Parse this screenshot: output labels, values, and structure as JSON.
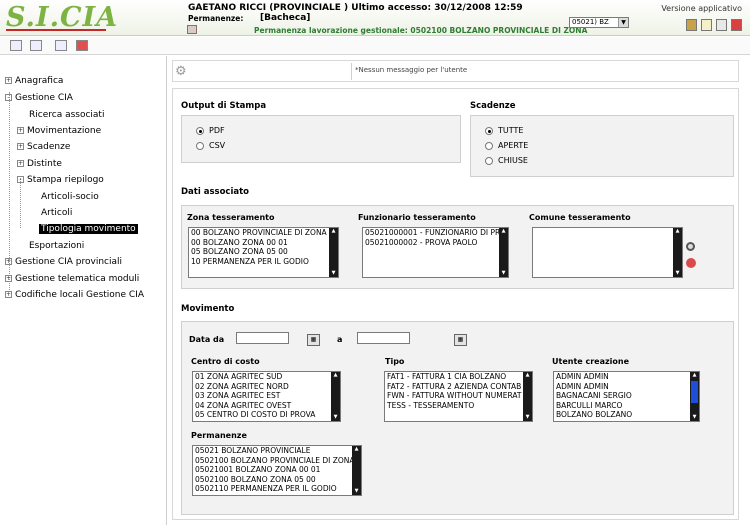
{
  "header": {
    "logo_text": "S.I.CIA",
    "user_line": "GAETANO RICCI (PROVINCIALE ) Ultimo accesso: 30/12/2008 12:59",
    "perm_label": "Permanenze:",
    "perm_value": "[Bacheca]",
    "perm_gestionale": "Permanenza lavorazione gestionale: 0502100 BOLZANO PROVINCIALE DI ZONA",
    "version": "Versione applicativo",
    "zone_select": "05021) BZ"
  },
  "sidebar": {
    "items": [
      {
        "label": "Anagrafica",
        "expander": "+"
      },
      {
        "label": "Gestione CIA",
        "expander": "-"
      },
      {
        "label": "Ricerca associati",
        "expander": ""
      },
      {
        "label": "Movimentazione",
        "expander": "+"
      },
      {
        "label": "Scadenze",
        "expander": "+"
      },
      {
        "label": "Distinte",
        "expander": "+"
      },
      {
        "label": "Stampa riepilogo",
        "expander": "-"
      },
      {
        "label": "Articoli-socio",
        "expander": ""
      },
      {
        "label": "Articoli",
        "expander": ""
      },
      {
        "label": "Tipologia movimento",
        "expander": ""
      },
      {
        "label": "Esportazioni",
        "expander": ""
      },
      {
        "label": "Gestione CIA provinciali",
        "expander": "+"
      },
      {
        "label": "Gestione telematica moduli",
        "expander": "+"
      },
      {
        "label": "Codifiche locali Gestione CIA",
        "expander": "+"
      }
    ]
  },
  "message": "*Nessun messaggio per l'utente",
  "output": {
    "title": "Output di Stampa",
    "options": [
      "PDF",
      "CSV"
    ],
    "selected": "PDF"
  },
  "scadenze": {
    "title": "Scadenze",
    "options": [
      "TUTTE",
      "APERTE",
      "CHIUSE"
    ],
    "selected": "TUTTE"
  },
  "dati_associato": {
    "title": "Dati associato",
    "zona_label": "Zona tesseramento",
    "zona_options": [
      "00 BOLZANO PROVINCIALE DI ZONA",
      "00 BOLZANO ZONA 00 01",
      "05 BOLZANO ZONA 05 00",
      "10 PERMANENZA PER IL GODIO"
    ],
    "funz_label": "Funzionario tesseramento",
    "funz_options": [
      "05021000001 - FUNZIONARIO DI PR",
      "05021000002 - PROVA PAOLO"
    ],
    "comune_label": "Comune tesseramento",
    "comune_options": []
  },
  "movimento": {
    "title": "Movimento",
    "data_da_label": "Data da",
    "a_label": "a",
    "data_da_value": "",
    "a_value": "",
    "centro_label": "Centro di costo",
    "centro_options": [
      "01 ZONA AGRITEC SUD",
      "02 ZONA AGRITEC NORD",
      "03 ZONA AGRITEC EST",
      "04 ZONA AGRITEC OVEST",
      "05 CENTRO DI COSTO DI PROVA"
    ],
    "tipo_label": "Tipo",
    "tipo_options": [
      "FAT1 - FATTURA 1 CIA BOLZANO",
      "FAT2 - FATTURA 2 AZIENDA CONTAB",
      "FWN - FATTURA WITHOUT NUMERAT",
      "TESS - TESSERAMENTO"
    ],
    "utente_label": "Utente creazione",
    "utente_options": [
      "ADMIN ADMIN",
      "ADMIN ADMIN",
      "BAGNACANI SERGIO",
      "BARCULLI MARCO",
      "BOLZANO BOLZANO"
    ],
    "perm_label": "Permanenze",
    "perm_options": [
      "05021 BOLZANO PROVINCIALE",
      "0502100 BOLZANO PROVINCIALE DI ZONA",
      "05021001 BOLZANO ZONA 00 01",
      "0502100 BOLZANO ZONA 05 00",
      "0502110 PERMANENZA PER IL GODIO"
    ]
  },
  "colors": {
    "logo_green": "#7cb342",
    "gestionale_green": "#2e7d32",
    "scroll_thumb": "#1e4fd8"
  }
}
